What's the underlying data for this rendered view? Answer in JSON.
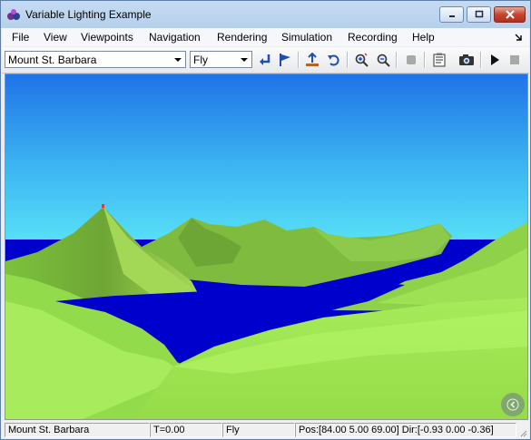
{
  "window": {
    "title": "Variable Lighting Example"
  },
  "menu": {
    "items": [
      "File",
      "View",
      "Viewpoints",
      "Navigation",
      "Rendering",
      "Simulation",
      "Recording",
      "Help"
    ]
  },
  "toolbar": {
    "viewpoint_select": "Mount St. Barbara",
    "navigation_mode_select": "Fly",
    "icons": [
      "return-icon",
      "flag-icon",
      "straighten-up-icon",
      "undo-icon",
      "zoom-in-icon",
      "zoom-out-icon",
      "stop-record-icon",
      "notes-icon",
      "camera-icon",
      "play-icon",
      "stop-icon"
    ]
  },
  "colors": {
    "sky_top": "#1f73e6",
    "sky_bottom": "#5ce8f8",
    "water": "#0000cc",
    "terrain_light": "#aef15a",
    "terrain_dark": "#6ea635"
  },
  "status": {
    "viewpoint": "Mount St. Barbara",
    "time": "T=0.00",
    "mode": "Fly",
    "position_direction": "Pos:[84.00 5.00 69.00] Dir:[-0.93 0.00 -0.36]"
  }
}
